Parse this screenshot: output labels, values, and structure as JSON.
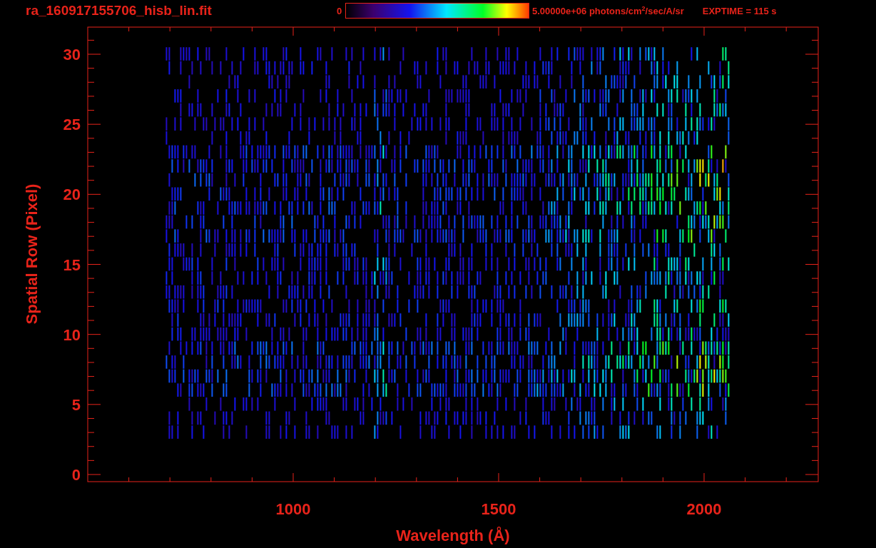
{
  "header": {
    "title": "ra_160917155706_hisb_lin.fit",
    "colorbar": {
      "min_label": "0",
      "max_label": "5.00000e+06 photons/cm$^{2}$/sec/A/sr"
    },
    "exposure": "EXPTIME = 115 s"
  },
  "plot": {
    "x_axis": {
      "label": "Wavelength (Å)",
      "tick_labels": [
        "1000",
        "1500",
        "2000"
      ]
    },
    "y_axis": {
      "label": "Spatial Row (Pixel)",
      "tick_labels": [
        "30",
        "25",
        "20",
        "15",
        "10",
        "5",
        "0"
      ]
    }
  }
}
